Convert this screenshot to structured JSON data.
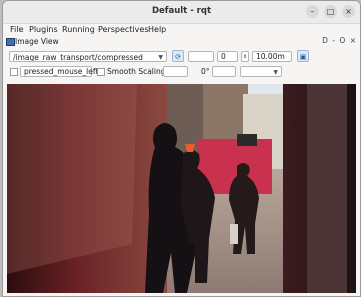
{
  "window": {
    "title": "Default - rqt"
  },
  "window_controls": {
    "minimize": "–",
    "maximize": "□",
    "close": "×"
  },
  "menu": [
    {
      "label": "File"
    },
    {
      "label": "Plugins"
    },
    {
      "label": "Running"
    },
    {
      "label": "Perspectives"
    },
    {
      "label": "Help"
    }
  ],
  "dock": {
    "title": "Image View",
    "buttons": "D  - O ×"
  },
  "toolbar": {
    "topic": "/image_raw_transport/compressed",
    "spin_value": "0",
    "range_value": "10.00m",
    "mouse_topic": "pressed_mouse_left",
    "smooth_scaling_label": "Smooth Scaling",
    "rotation_value": "0°"
  },
  "colors": {
    "accent": "#3f6fb0",
    "tool_button": "#dbe8f7"
  }
}
